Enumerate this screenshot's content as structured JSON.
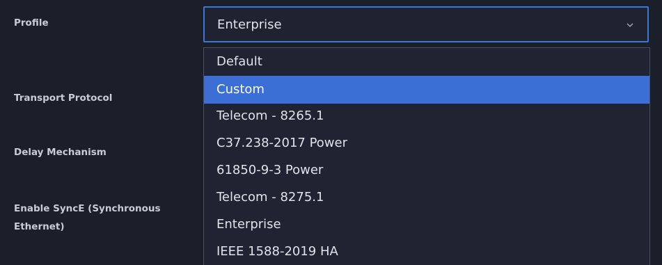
{
  "form": {
    "labels": {
      "profile": "Profile",
      "transport_protocol": "Transport Protocol",
      "delay_mechanism": "Delay Mechanism",
      "enable_synce": "Enable SyncE (Synchronous Ethernet)"
    },
    "profile_select": {
      "value": "Enterprise",
      "icon": "chevron-down-icon",
      "options": [
        {
          "label": "Default"
        },
        {
          "label": "Custom",
          "highlighted": true
        },
        {
          "label": "Telecom - 8265.1"
        },
        {
          "label": "C37.238-2017 Power"
        },
        {
          "label": "61850-9-3 Power"
        },
        {
          "label": "Telecom - 8275.1"
        },
        {
          "label": "Enterprise"
        },
        {
          "label": "IEEE 1588-2019 HA"
        }
      ]
    }
  },
  "colors": {
    "background": "#1b1f2a",
    "accent": "#3b6fd6",
    "text": "#dfe3ea"
  }
}
